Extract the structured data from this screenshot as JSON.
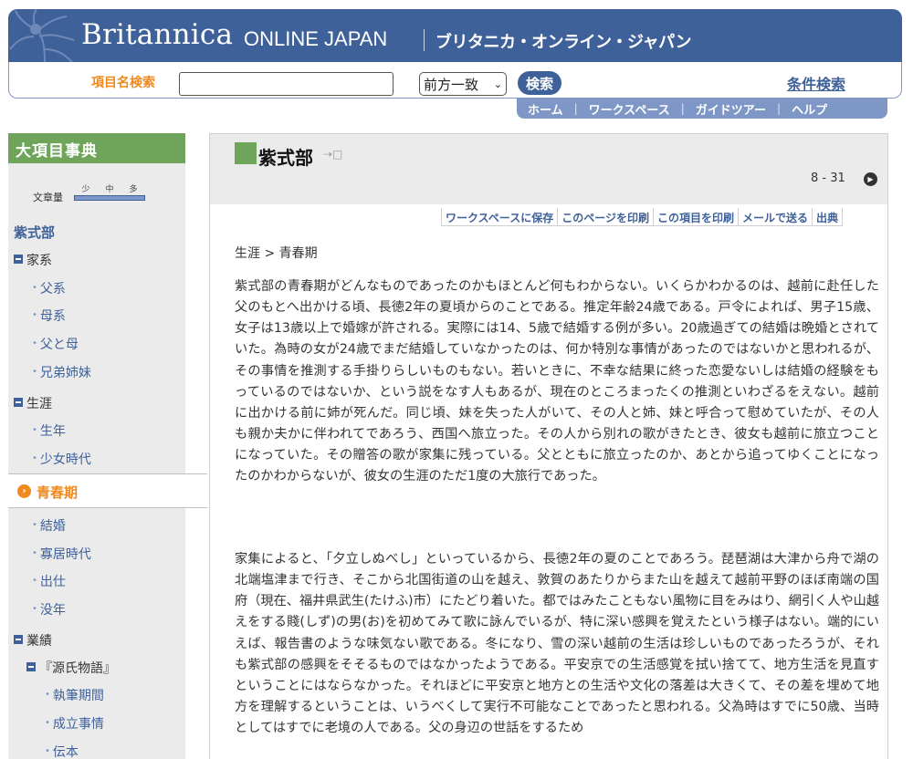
{
  "header": {
    "logo_main": "Britannica",
    "logo_sub": "ONLINE JAPAN",
    "logo_jp": "ブリタニカ・オンライン・ジャパン"
  },
  "search": {
    "label": "項目名検索",
    "value": "",
    "match_mode": "前方一致",
    "button": "検索",
    "advanced": "条件検索"
  },
  "nav": {
    "tabs": [
      "ホーム",
      "ワークスペース",
      "ガイドツアー",
      "ヘルプ"
    ]
  },
  "sidebar": {
    "title": "大項目事典",
    "volume_label": "文章量",
    "volume_marks": [
      "少",
      "中",
      "多"
    ],
    "topic": "紫式部",
    "groups": [
      {
        "label": "家系",
        "items": [
          "父系",
          "母系",
          "父と母",
          "兄弟姉妹"
        ]
      },
      {
        "label": "生涯",
        "items": [
          "生年",
          "少女時代"
        ]
      }
    ],
    "current": "青春期",
    "after_current": [
      "結婚",
      "寡居時代",
      "出仕",
      "没年"
    ],
    "works": {
      "label": "業績",
      "sub": "『源氏物語』",
      "sub_items": [
        "執筆期間",
        "成立事情",
        "伝本"
      ]
    }
  },
  "article": {
    "title": "紫式部",
    "pager": "8 - 31",
    "actions": [
      "ワークスペースに保存",
      "このページを印刷",
      "この項目を印刷",
      "メールで送る",
      "出典"
    ],
    "breadcrumb": "生涯 > 青春期",
    "paragraphs": [
      "紫式部の青春期がどんなものであったのかもほとんど何もわからない。いくらかわかるのは、越前に赴任した父のもとへ出かける頃、長徳2年の夏頃からのことである。推定年齢24歳である。戸令によれば、男子15歳、女子は13歳以上で婚嫁が許される。実際には14、5歳で結婚する例が多い。20歳過ぎての結婚は晩婚とされていた。為時の女が24歳でまだ結婚していなかったのは、何か特別な事情があったのではないかと思われるが、その事情を推測する手掛りらしいものもない。若いときに、不幸な結果に終った恋愛ないしは結婚の経験をもっているのではないか、という説をなす人もあるが、現在のところまったくの推測といわざるをえない。越前に出かける前に姉が死んだ。同じ頃、妹を失った人がいて、その人と姉、妹と呼合って慰めていたが、その人も親か夫かに伴われてであろう、西国へ旅立った。その人から別れの歌がきたとき、彼女も越前に旅立つことになっていた。その贈答の歌が家集に残っている。父とともに旅立ったのか、あとから追ってゆくことになったのかわからないが、彼女の生涯のただ1度の大旅行であった。",
      "家集によると、「夕立しぬべし」といっているから、長徳2年の夏のことであろう。琵琶湖は大津から舟で湖の北端塩津まで行き、そこから北国街道の山を越え、敦賀のあたりからまた山を越えて越前平野のほぼ南端の国府（現在、福井県武生(たけふ)市）にたどり着いた。都ではみたこともない風物に目をみはり、網引く人や山越えをする賤(しず)の男(お)を初めてみて歌に詠んでいるが、特に深い感興を覚えたという様子はない。端的にいえば、報告書のような味気ない歌である。冬になり、雪の深い越前の生活は珍しいものであったろうが、それも紫式部の感興をそそるものではなかったようである。平安京での生活感覚を拭い捨てて、地方生活を見直すということにはならなかった。それほどに平安京と地方との生活や文化の落差は大きくて、その差を埋めて地方を理解するということは、いうべくして実行不可能なことであったと思われる。父為時はすでに50歳、当時としてはすでに老境の人である。父の身辺の世話をするため"
    ]
  },
  "colors": {
    "brand_blue": "#3f619a",
    "accent_orange": "#f0891e",
    "accent_green": "#6ea55a"
  }
}
